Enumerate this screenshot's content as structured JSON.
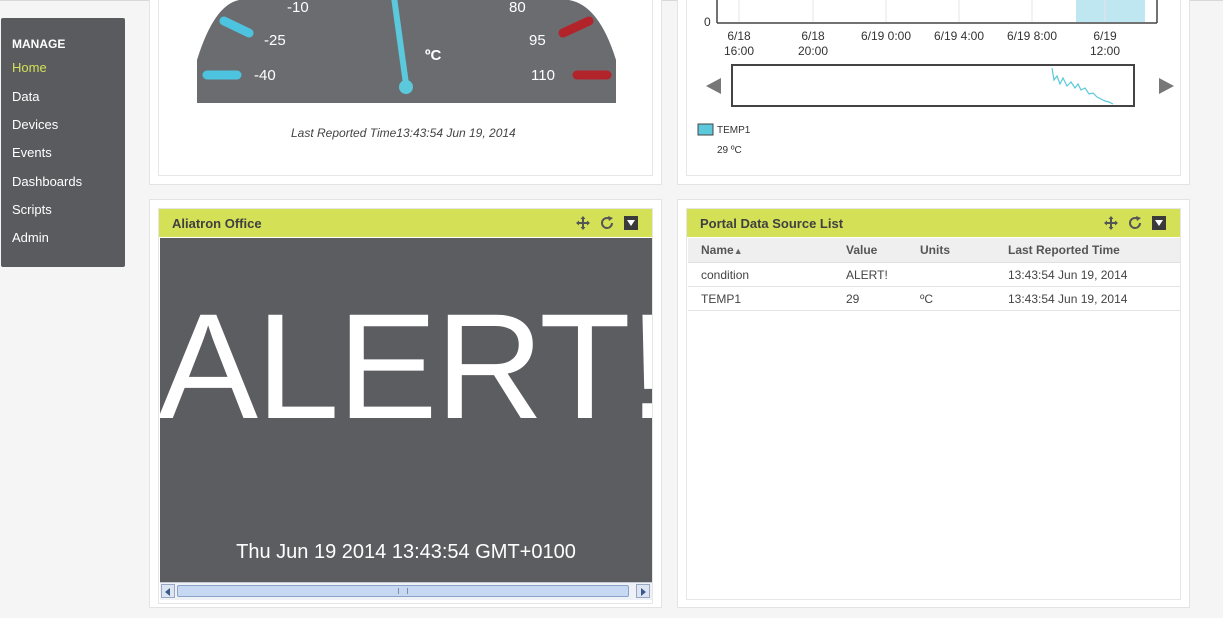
{
  "sidebar": {
    "heading": "MANAGE",
    "items": [
      {
        "label": "Home",
        "active": true
      },
      {
        "label": "Data"
      },
      {
        "label": "Devices"
      },
      {
        "label": "Events"
      },
      {
        "label": "Dashboards"
      },
      {
        "label": "Scripts"
      },
      {
        "label": "Admin"
      }
    ]
  },
  "gauge": {
    "tick_labels": {
      "m10": "-10",
      "m25": "-25",
      "m40": "-40",
      "p80": "80",
      "p95": "95",
      "p110": "110"
    },
    "unit": "ºC",
    "value": 29,
    "caption": "Last Reported Time13:43:54 Jun 19, 2014"
  },
  "chart": {
    "y_tick": "0",
    "x_ticks": [
      {
        "line1": "6/18",
        "line2": "16:00"
      },
      {
        "line1": "6/18",
        "line2": "20:00"
      },
      {
        "line1": "6/19 0:00",
        "line2": ""
      },
      {
        "line1": "6/19 4:00",
        "line2": ""
      },
      {
        "line1": "6/19 8:00",
        "line2": ""
      },
      {
        "line1": "6/19",
        "line2": "12:00"
      }
    ],
    "legend": {
      "name": "TEMP1",
      "value": "29 ºC",
      "color": "#5bc8dc"
    }
  },
  "alert_widget": {
    "title": "Aliatron Office",
    "message": "ALERT!",
    "timestamp": "Thu Jun 19 2014 13:43:54 GMT+0100"
  },
  "data_list": {
    "title": "Portal Data Source List",
    "columns": [
      "Name",
      "Value",
      "Units",
      "Last Reported Time"
    ],
    "rows": [
      {
        "name": "condition",
        "value": "ALERT!",
        "units": "",
        "time": "13:43:54 Jun 19, 2014"
      },
      {
        "name": "TEMP1",
        "value": "29",
        "units": "ºC",
        "time": "13:43:54 Jun 19, 2014"
      }
    ]
  },
  "colors": {
    "accent": "#d4e157",
    "panel_dark": "#5c5d61",
    "cold": "#4ec3df",
    "hot": "#b3242a"
  }
}
